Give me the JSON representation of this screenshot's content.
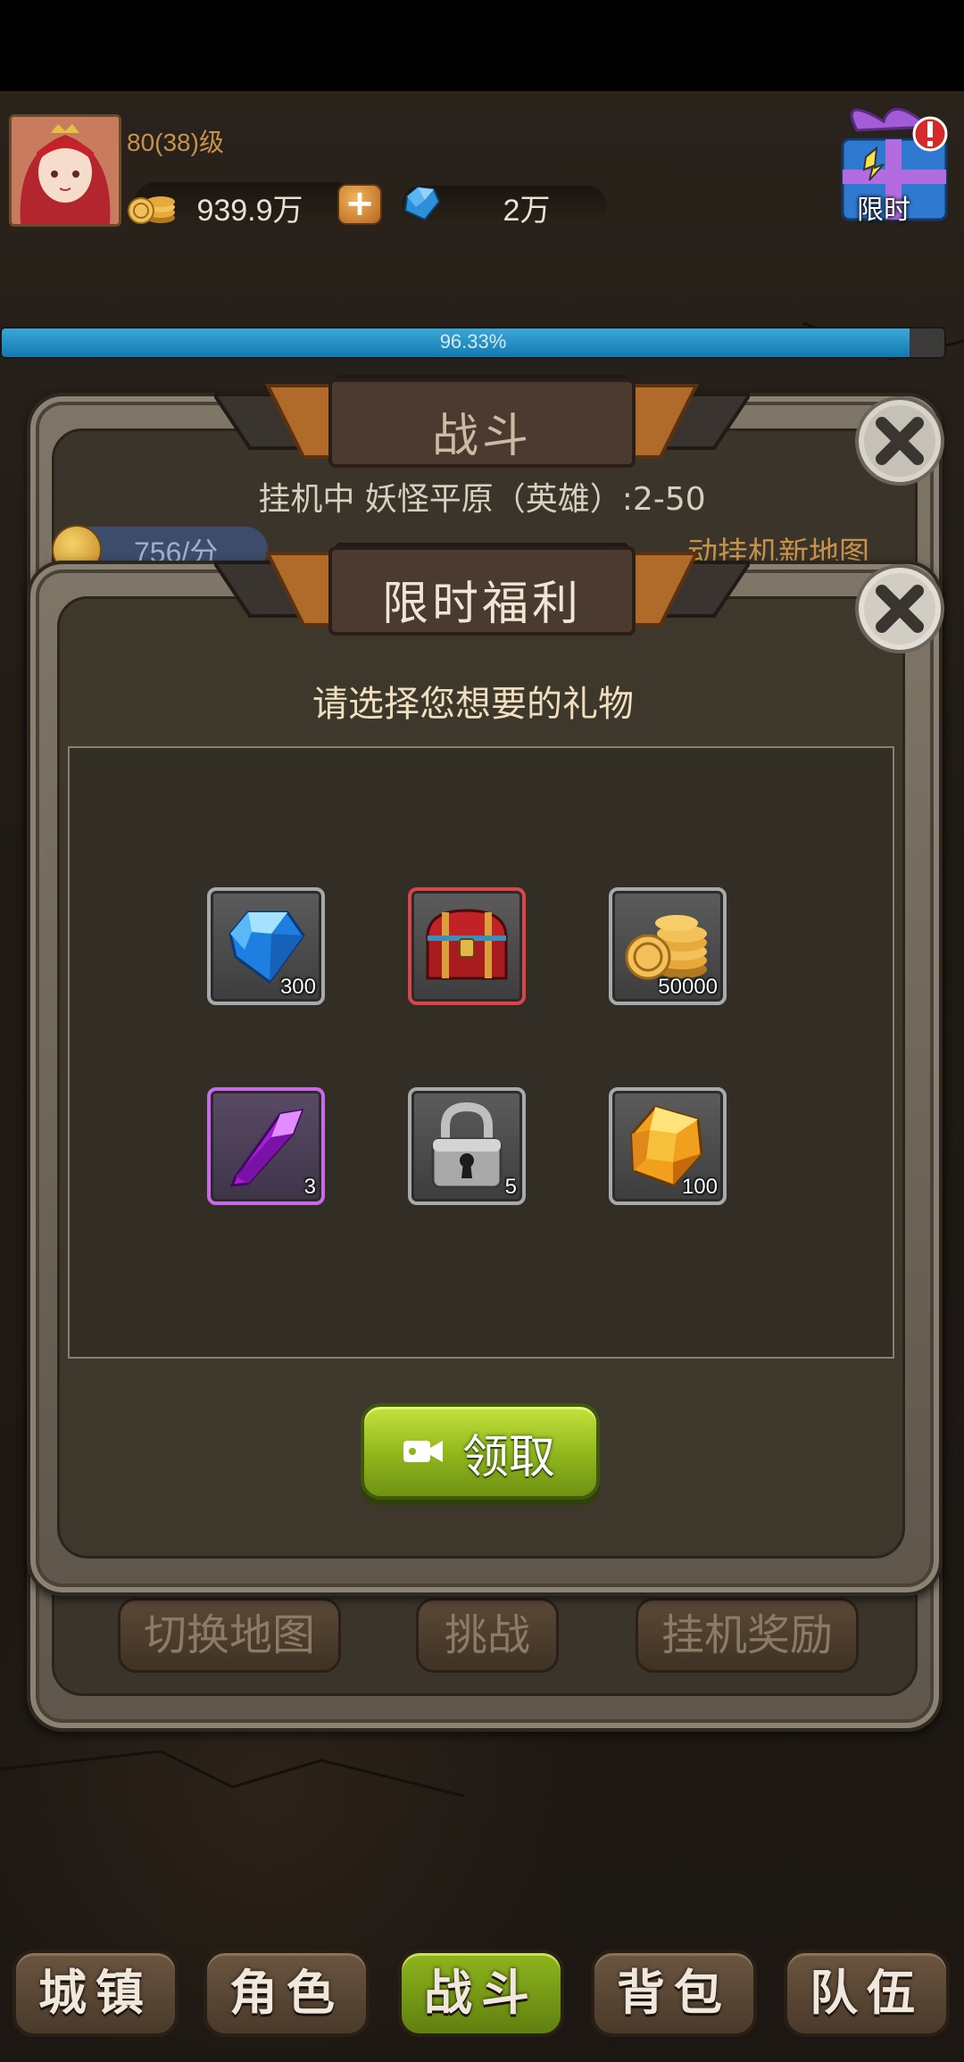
{
  "hud": {
    "level": "80(38)级",
    "gold": "939.9万",
    "gems": "2万",
    "gift_label": "限时",
    "exp_percent": 96.33,
    "exp_text": "96.33%"
  },
  "battle_panel": {
    "title": "战斗",
    "subtitle": "挂机中 妖怪平原（英雄）:2-50",
    "rate": "756/分",
    "auto_text": "动挂机新地图",
    "buttons": {
      "switch_map": "切换地图",
      "challenge": "挑战",
      "afk_reward": "挂机奖励"
    }
  },
  "popup": {
    "title": "限时福利",
    "prompt": "请选择您想要的礼物",
    "items": [
      {
        "icon": "blue-diamond-icon",
        "qty": "300"
      },
      {
        "icon": "treasure-chest-icon",
        "qty": ""
      },
      {
        "icon": "gold-coins-icon",
        "qty": "50000"
      },
      {
        "icon": "purple-crystal-icon",
        "qty": "3"
      },
      {
        "icon": "padlock-icon",
        "qty": "5"
      },
      {
        "icon": "amber-gem-icon",
        "qty": "100"
      }
    ],
    "claim_label": "领取"
  },
  "nav": {
    "town": "城镇",
    "role": "角色",
    "battle": "战斗",
    "bag": "背包",
    "team": "队伍"
  },
  "colors": {
    "accent_green": "#8fb51c",
    "exp_blue": "#1e90c8",
    "rare_red": "#d9454a",
    "epic_purple": "#c96be8"
  }
}
